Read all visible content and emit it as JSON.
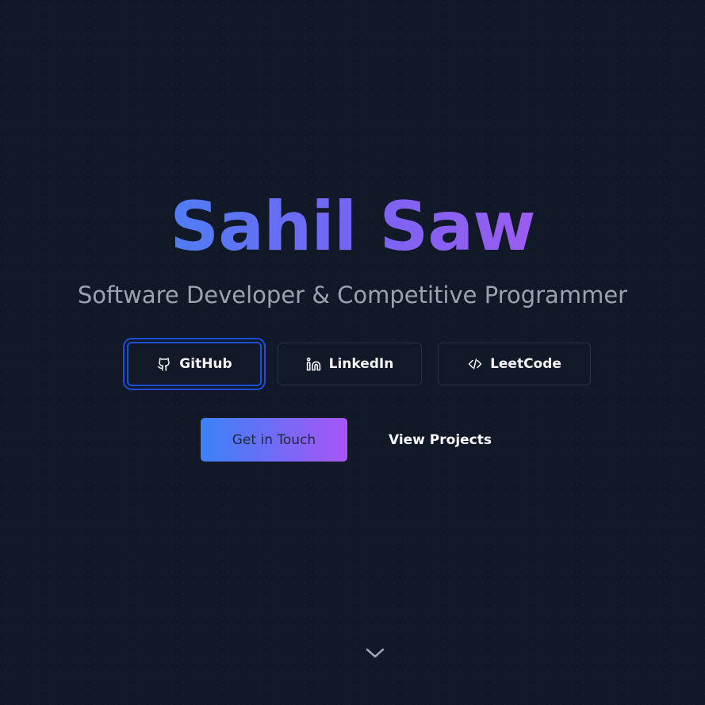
{
  "hero": {
    "name": "Sahil Saw",
    "subtitle": "Software Developer & Competitive Programmer"
  },
  "social_links": [
    {
      "label": "GitHub",
      "icon": "github-icon"
    },
    {
      "label": "LinkedIn",
      "icon": "linkedin-icon"
    },
    {
      "label": "LeetCode",
      "icon": "code-icon"
    }
  ],
  "actions": {
    "primary_label": "Get in Touch",
    "secondary_label": "View Projects"
  },
  "scroll_indicator": {
    "icon": "chevron-down-icon"
  },
  "colors": {
    "background": "#111827",
    "gradient_start": "#3b82f6",
    "gradient_end": "#a855f7",
    "subtitle": "#9ca3af",
    "focus_ring": "#1d4ed8"
  }
}
